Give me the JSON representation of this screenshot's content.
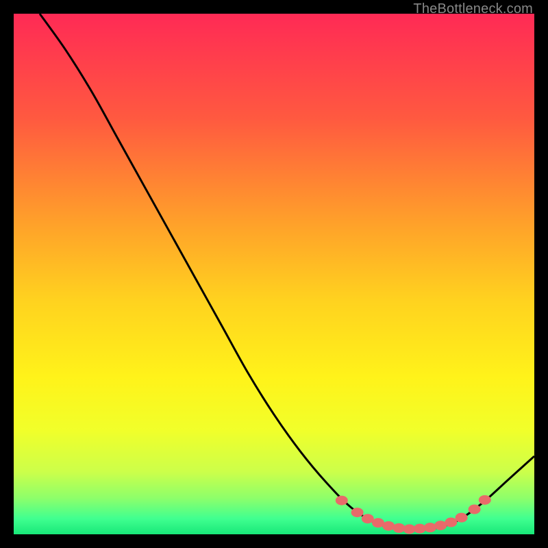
{
  "watermark": "TheBottleneck.com",
  "chart_data": {
    "type": "line",
    "title": "",
    "xlabel": "",
    "ylabel": "",
    "xlim": [
      0,
      100
    ],
    "ylim": [
      0,
      100
    ],
    "gradient_stops": [
      {
        "offset": 0.0,
        "color": "#ff2a55"
      },
      {
        "offset": 0.2,
        "color": "#ff5940"
      },
      {
        "offset": 0.4,
        "color": "#ffa02a"
      },
      {
        "offset": 0.55,
        "color": "#ffd21f"
      },
      {
        "offset": 0.7,
        "color": "#fff31a"
      },
      {
        "offset": 0.8,
        "color": "#f1ff2a"
      },
      {
        "offset": 0.88,
        "color": "#ccff4a"
      },
      {
        "offset": 0.93,
        "color": "#8eff6a"
      },
      {
        "offset": 0.97,
        "color": "#40ff90"
      },
      {
        "offset": 1.0,
        "color": "#18e878"
      }
    ],
    "curve": [
      {
        "x": 5.0,
        "y": 100.0
      },
      {
        "x": 10.0,
        "y": 93.0
      },
      {
        "x": 15.0,
        "y": 85.0
      },
      {
        "x": 20.0,
        "y": 76.0
      },
      {
        "x": 25.0,
        "y": 67.0
      },
      {
        "x": 30.0,
        "y": 58.0
      },
      {
        "x": 35.0,
        "y": 49.0
      },
      {
        "x": 40.0,
        "y": 40.0
      },
      {
        "x": 45.0,
        "y": 31.0
      },
      {
        "x": 50.0,
        "y": 23.0
      },
      {
        "x": 55.0,
        "y": 16.0
      },
      {
        "x": 60.0,
        "y": 10.0
      },
      {
        "x": 65.0,
        "y": 5.0
      },
      {
        "x": 70.0,
        "y": 2.0
      },
      {
        "x": 75.0,
        "y": 1.0
      },
      {
        "x": 80.0,
        "y": 1.0
      },
      {
        "x": 85.0,
        "y": 2.5
      },
      {
        "x": 90.0,
        "y": 6.0
      },
      {
        "x": 95.0,
        "y": 10.5
      },
      {
        "x": 100.0,
        "y": 15.0
      }
    ],
    "markers": [
      {
        "x": 63.0,
        "y": 6.5
      },
      {
        "x": 66.0,
        "y": 4.2
      },
      {
        "x": 68.0,
        "y": 3.0
      },
      {
        "x": 70.0,
        "y": 2.2
      },
      {
        "x": 72.0,
        "y": 1.6
      },
      {
        "x": 74.0,
        "y": 1.2
      },
      {
        "x": 76.0,
        "y": 1.0
      },
      {
        "x": 78.0,
        "y": 1.1
      },
      {
        "x": 80.0,
        "y": 1.3
      },
      {
        "x": 82.0,
        "y": 1.7
      },
      {
        "x": 84.0,
        "y": 2.3
      },
      {
        "x": 86.0,
        "y": 3.2
      },
      {
        "x": 88.5,
        "y": 4.8
      },
      {
        "x": 90.5,
        "y": 6.6
      }
    ],
    "marker_color": "#e86a6a",
    "curve_color": "#000000"
  }
}
